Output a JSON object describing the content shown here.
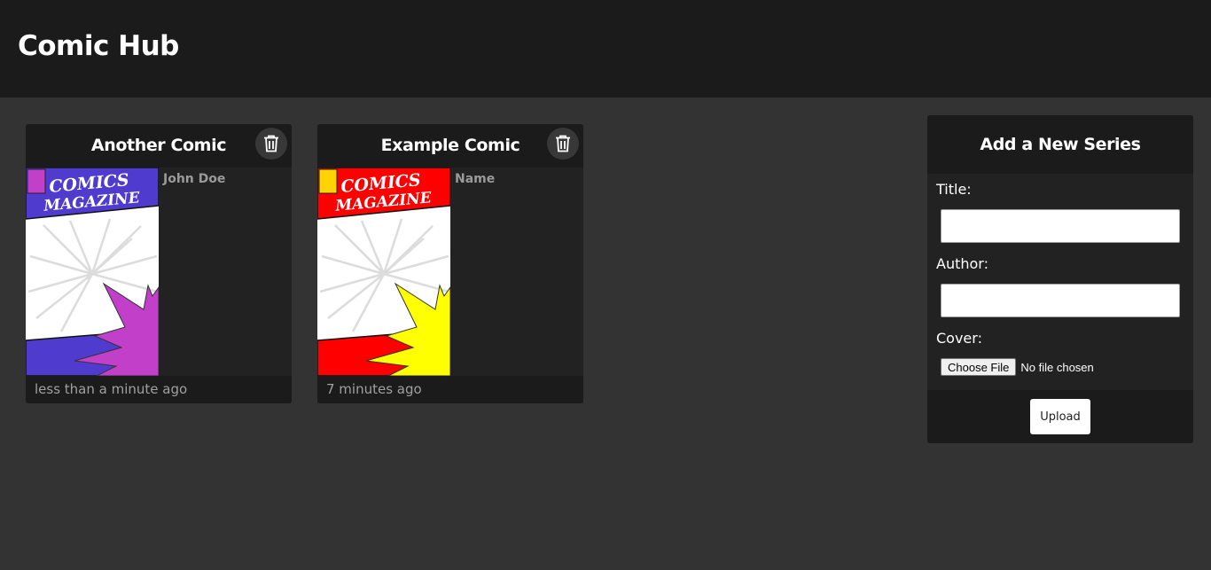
{
  "app": {
    "title": "Comic Hub"
  },
  "comics": [
    {
      "title": "Another Comic",
      "author": "John Doe",
      "time": "less than a minute ago",
      "cover": {
        "line1": "COMICS",
        "line2": "MAGAZINE",
        "accent": "#4f3ccf",
        "burst": "#c23fc9",
        "square": "#c23fc9",
        "strip": "#4f3ccf"
      }
    },
    {
      "title": "Example Comic",
      "author": "Name",
      "time": "7 minutes ago",
      "cover": {
        "line1": "COMICS",
        "line2": "MAGAZINE",
        "accent": "#ff0000",
        "burst": "#ffff00",
        "square": "#ffd400",
        "strip": "#ff0000"
      }
    }
  ],
  "form": {
    "heading": "Add a New Series",
    "title_label": "Title:",
    "title_value": "",
    "author_label": "Author:",
    "author_value": "",
    "cover_label": "Cover:",
    "file_button": "Choose File",
    "file_status": "No file chosen",
    "upload_label": "Upload"
  },
  "colors": {
    "page_bg": "#333333",
    "header_bg": "#1b1b1b",
    "card_bg": "#222222",
    "muted_text": "#a0a0a0"
  },
  "icons": {
    "delete": "trash-icon"
  }
}
